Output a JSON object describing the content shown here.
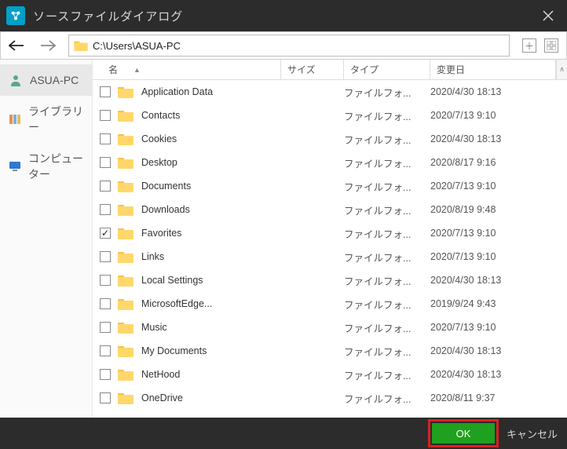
{
  "titlebar": {
    "title": "ソースファイルダイアログ"
  },
  "nav": {
    "path": "C:\\Users\\ASUA-PC"
  },
  "sidebar": {
    "items": [
      {
        "label": "ASUA-PC",
        "icon": "user",
        "selected": true
      },
      {
        "label": "ライブラリー",
        "icon": "library",
        "selected": false
      },
      {
        "label": "コンピューター",
        "icon": "computer",
        "selected": false
      }
    ]
  },
  "columns": {
    "name": "名",
    "size": "サイズ",
    "type": "タイプ",
    "date": "変更日"
  },
  "rows": [
    {
      "name": "Application Data",
      "type": "ファイルフォ...",
      "date": "2020/4/30 18:13",
      "checked": false
    },
    {
      "name": "Contacts",
      "type": "ファイルフォ...",
      "date": "2020/7/13 9:10",
      "checked": false
    },
    {
      "name": "Cookies",
      "type": "ファイルフォ...",
      "date": "2020/4/30 18:13",
      "checked": false
    },
    {
      "name": "Desktop",
      "type": "ファイルフォ...",
      "date": "2020/8/17 9:16",
      "checked": false
    },
    {
      "name": "Documents",
      "type": "ファイルフォ...",
      "date": "2020/7/13 9:10",
      "checked": false
    },
    {
      "name": "Downloads",
      "type": "ファイルフォ...",
      "date": "2020/8/19 9:48",
      "checked": false
    },
    {
      "name": "Favorites",
      "type": "ファイルフォ...",
      "date": "2020/7/13 9:10",
      "checked": true
    },
    {
      "name": "Links",
      "type": "ファイルフォ...",
      "date": "2020/7/13 9:10",
      "checked": false
    },
    {
      "name": "Local Settings",
      "type": "ファイルフォ...",
      "date": "2020/4/30 18:13",
      "checked": false
    },
    {
      "name": "MicrosoftEdge...",
      "type": "ファイルフォ...",
      "date": "2019/9/24 9:43",
      "checked": false
    },
    {
      "name": "Music",
      "type": "ファイルフォ...",
      "date": "2020/7/13 9:10",
      "checked": false
    },
    {
      "name": "My Documents",
      "type": "ファイルフォ...",
      "date": "2020/4/30 18:13",
      "checked": false
    },
    {
      "name": "NetHood",
      "type": "ファイルフォ...",
      "date": "2020/4/30 18:13",
      "checked": false
    },
    {
      "name": "OneDrive",
      "type": "ファイルフォ...",
      "date": "2020/8/11 9:37",
      "checked": false
    }
  ],
  "footer": {
    "ok": "OK",
    "cancel": "キャンセル"
  }
}
